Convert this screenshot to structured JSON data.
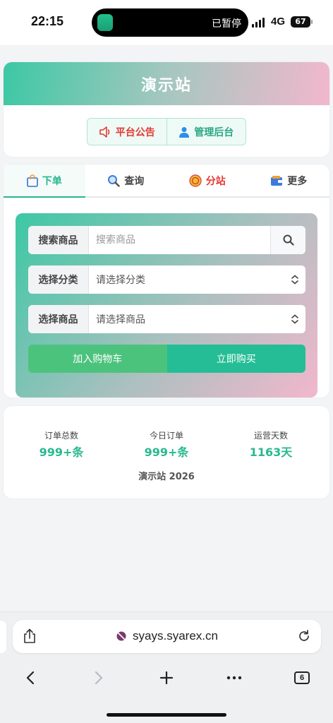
{
  "status_bar": {
    "time": "22:15",
    "island_text": "已暂停",
    "network": "4G",
    "battery": "67"
  },
  "header": {
    "site_title": "演示站",
    "notice_label": "平台公告",
    "admin_label": "管理后台"
  },
  "tabs": [
    {
      "label": "下单",
      "icon": "bag-icon"
    },
    {
      "label": "查询",
      "icon": "search-icon"
    },
    {
      "label": "分站",
      "icon": "coin-icon"
    },
    {
      "label": "更多",
      "icon": "wallet-icon"
    }
  ],
  "form": {
    "search": {
      "label": "搜索商品",
      "placeholder": "搜索商品"
    },
    "category": {
      "label": "选择分类",
      "value": "请选择分类"
    },
    "product": {
      "label": "选择商品",
      "value": "请选择商品"
    },
    "add_to_cart": "加入购物车",
    "buy_now": "立即购买"
  },
  "stats": [
    {
      "label": "订单总数",
      "value": "999+条"
    },
    {
      "label": "今日订单",
      "value": "999+条"
    },
    {
      "label": "运营天数",
      "value": "1163天"
    }
  ],
  "footer": "演示站 2026",
  "browser": {
    "url": "syays.syarex.cn",
    "tab_count": "6"
  },
  "colors": {
    "accent": "#26b58e",
    "notice_red": "#e53935",
    "cart_green": "#4cc37d",
    "buy_teal": "#25bd96",
    "gradient_start": "#3cc8a4",
    "gradient_end": "#f2b7cc"
  }
}
